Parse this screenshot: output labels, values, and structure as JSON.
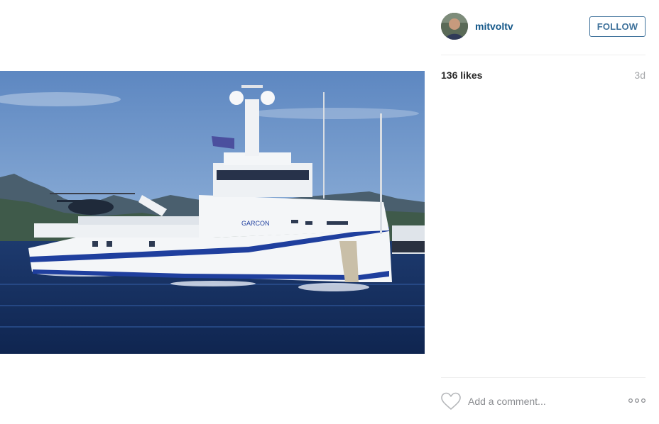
{
  "post": {
    "image_alt": "Garcon support yacht at sea with helicopter",
    "hull_name": "GARCON"
  },
  "header": {
    "username": "mitvoltv",
    "follow_label": "FOLLOW"
  },
  "stats": {
    "likes": "136 likes",
    "time_ago": "3d"
  },
  "comment": {
    "placeholder": "Add a comment..."
  },
  "icons": {
    "like": "heart-outline-icon",
    "more": "more-options-icon"
  },
  "colors": {
    "link": "#125688",
    "follow_border": "#3f729b",
    "muted": "#a5a7aa"
  }
}
